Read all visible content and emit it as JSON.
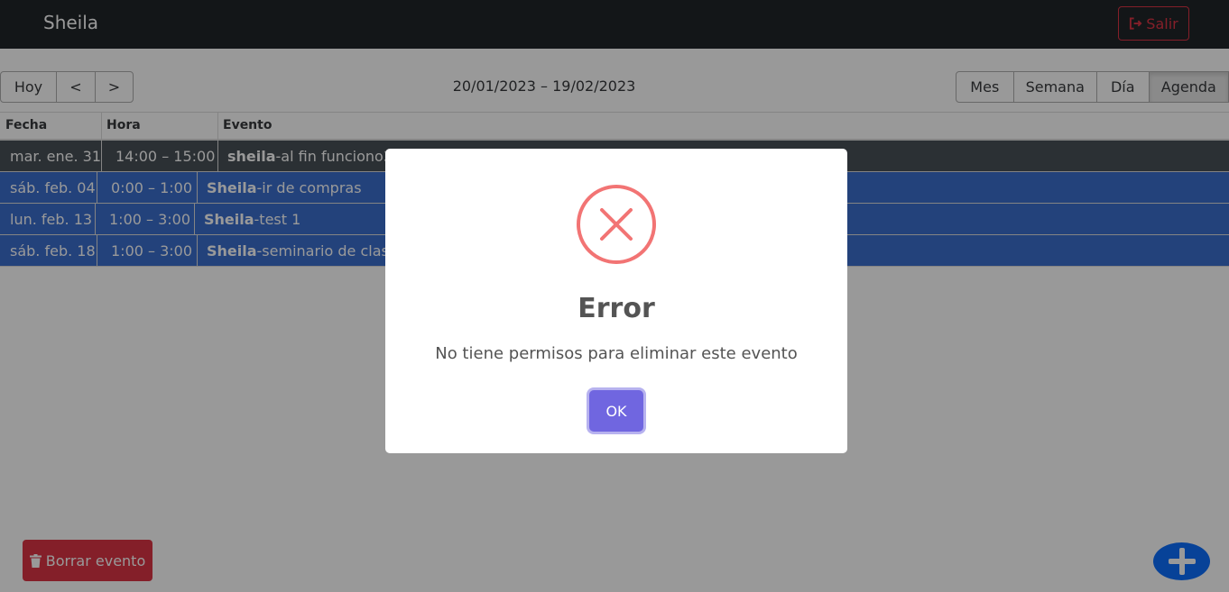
{
  "navbar": {
    "brand": "Sheila",
    "logout_label": "Salir"
  },
  "toolbar": {
    "nav_buttons": [
      "Hoy",
      "<",
      ">"
    ],
    "range_label": "20/01/2023 – 19/02/2023",
    "views": [
      "Mes",
      "Semana",
      "Día",
      "Agenda"
    ],
    "active_view": "Agenda"
  },
  "agenda": {
    "headers": [
      "Fecha",
      "Hora",
      "Evento"
    ],
    "rows": [
      {
        "date": "mar. ene. 31",
        "time": "14:00 – 15:00",
        "owner": "sheila",
        "title": "-al fin funciono3",
        "color": "#495057"
      },
      {
        "date": "sáb. feb. 04",
        "time": "0:00 – 1:00",
        "owner": "Sheila",
        "title": "-ir de compras",
        "color": "#3b6ece"
      },
      {
        "date": "lun. feb. 13",
        "time": "1:00 – 3:00",
        "owner": "Sheila",
        "title": "-test 1",
        "color": "#3b6ece"
      },
      {
        "date": "sáb. feb. 18",
        "time": "1:00 – 3:00",
        "owner": "Sheila",
        "title": "-seminario de clases",
        "color": "#3b6ece"
      }
    ]
  },
  "actions": {
    "delete_label": "Borrar evento"
  },
  "modal": {
    "title": "Error",
    "text": "No tiene permisos para eliminar este evento",
    "ok_label": "OK",
    "icon": "error-x-icon",
    "icon_color": "#f27474",
    "button_color": "#7066e0"
  },
  "colors": {
    "navbar": "#212529",
    "danger": "#dc3545",
    "primary": "#0d6efd"
  }
}
